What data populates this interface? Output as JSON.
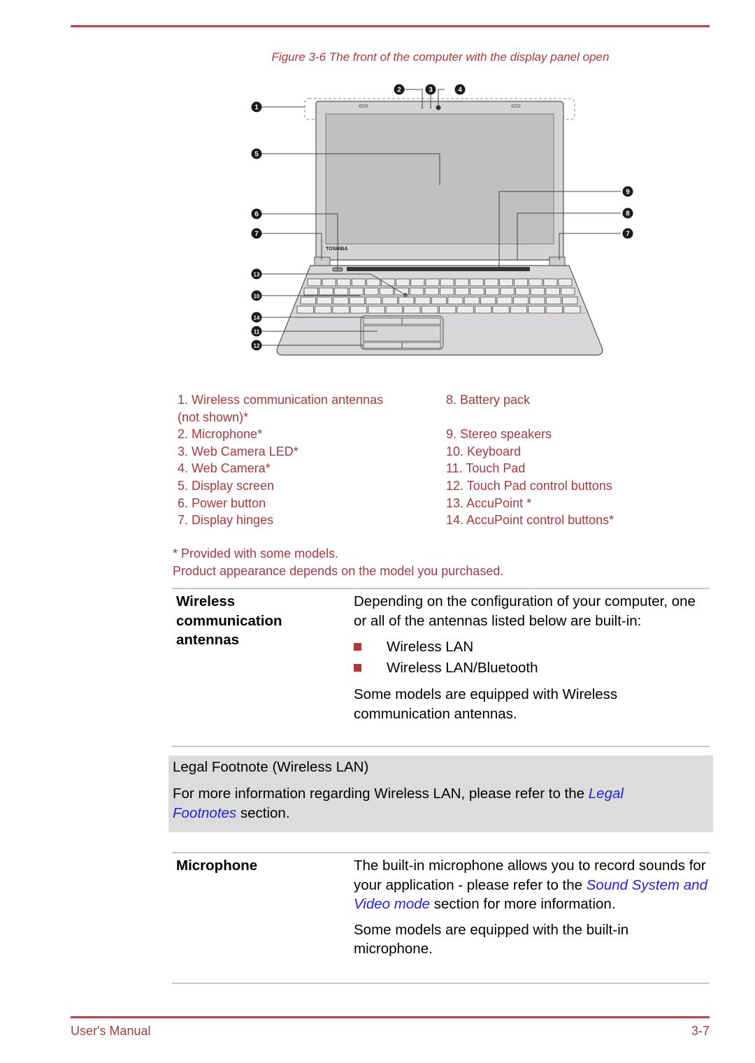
{
  "figure": {
    "caption": "Figure 3-6 The front of the computer with the display panel open",
    "brand_label": "TOSHIBA",
    "callouts": [
      "1",
      "2",
      "3",
      "4",
      "5",
      "6",
      "7",
      "7",
      "8",
      "9",
      "10",
      "11",
      "12",
      "13",
      "14"
    ]
  },
  "legend": {
    "left": [
      "1. Wireless communication antennas",
      "(not shown)*",
      "2. Microphone*",
      "3. Web Camera LED*",
      "4. Web Camera*",
      "5. Display screen",
      "6. Power button",
      "7. Display hinges"
    ],
    "right": [
      "8. Battery pack",
      "9. Stereo speakers",
      "10. Keyboard",
      "11. Touch Pad",
      "12. Touch Pad control buttons",
      "13. AccuPoint *",
      "14. AccuPoint control buttons*"
    ]
  },
  "notes": {
    "asterisk": "* Provided with some models.",
    "appearance": "Product appearance depends on the model you purchased."
  },
  "sections": {
    "wireless": {
      "term_line1": "Wireless",
      "term_line2": "communication",
      "term_line3": "antennas",
      "intro": "Depending on the configuration of your computer, one or all of the antennas listed below are built-in:",
      "bullets": [
        "Wireless LAN",
        "Wireless LAN/Bluetooth"
      ],
      "outro": "Some models are equipped with Wireless communication antennas."
    },
    "legal_note": {
      "title": "Legal Footnote (Wireless LAN)",
      "text_before": "For more information regarding Wireless LAN, please refer to the ",
      "link": "Legal Footnotes",
      "text_after": " section."
    },
    "microphone": {
      "term": "Microphone",
      "text_before": "The built-in microphone allows you to record sounds for your application - please refer to the ",
      "link": "Sound System and Video mode",
      "text_after": " section for more information.",
      "outro": "Some models are equipped with the built-in microphone."
    }
  },
  "footer": {
    "left": "User's Manual",
    "page": "3-7"
  },
  "colors": {
    "accent": "#a83a3e",
    "link": "#1f1fe0",
    "note_bg": "#dcdcdc"
  }
}
